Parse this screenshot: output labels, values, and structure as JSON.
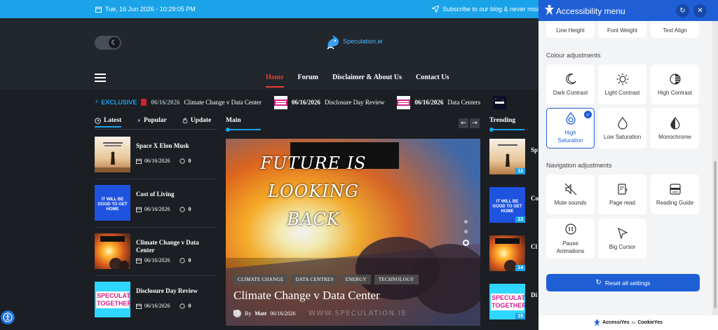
{
  "topbar": {
    "date": "Tue, 16 Jun 2026 - 10:29:05 PM",
    "subscribe": "Subscribe to our blog & never miss ou"
  },
  "header": {
    "logo_text": "Speculation.ie",
    "nav": [
      "Home",
      "Forum",
      "Disclaimer & About Us",
      "Contact Us"
    ]
  },
  "ticker": {
    "label": "EXCLUSIVE",
    "items": [
      {
        "date": "06/16/2026",
        "title": "Climate Change v Data Center"
      },
      {
        "date": "06/16/2026",
        "title": "Disclosure Day Review"
      },
      {
        "date": "06/16/2026",
        "title": "Data Centers"
      }
    ]
  },
  "left_tabs": [
    "Latest",
    "Popular",
    "Update"
  ],
  "posts": [
    {
      "title": "Space X Elon Musk",
      "date": "06/16/2026",
      "comments": "0"
    },
    {
      "title": "Cost of Living",
      "date": "06/16/2026",
      "comments": "0"
    },
    {
      "title": "Climate Change v Data Center",
      "date": "06/16/2026",
      "comments": "0"
    },
    {
      "title": "Disclosure Day Review",
      "date": "06/16/2026",
      "comments": "0"
    }
  ],
  "thumb_text": {
    "cost": "IT WILL BE GOOD TO GET HOME",
    "speculate": "SPECULATE TOGETHER"
  },
  "main": {
    "heading": "Main",
    "hero_text": [
      "FUTURE IS",
      "LOOKING",
      "BACK"
    ],
    "tags": [
      "CLIMATE CHANGE",
      "DATA CENTRES",
      "ENERGY",
      "TECHNOLOGY"
    ],
    "title": "Climate Change v Data Center",
    "author_prefix": "By",
    "author": "Matt",
    "date": "06/16/2026",
    "watermark": "WWW.SPECULATION.IE"
  },
  "trending": {
    "heading": "Trending",
    "items": [
      {
        "num": "12",
        "title": "Sp"
      },
      {
        "num": "13",
        "title": "Co"
      },
      {
        "num": "14",
        "title": "Cl"
      },
      {
        "num": "15",
        "title": "Di"
      }
    ]
  },
  "panel": {
    "title": "Accessibility menu",
    "top_row": [
      "Line Height",
      "Font Weight",
      "Text Align"
    ],
    "colour_label": "Colour adjustments",
    "colour": [
      "Dark Contrast",
      "Light Contrast",
      "High Contrast",
      "High Saturation",
      "Low Saturation",
      "Monochrome"
    ],
    "nav_label": "Navigation adjustments",
    "navigation": [
      "Mute sounds",
      "Page read",
      "Reading Guide",
      "Pause Animations",
      "Big Cursor"
    ],
    "reset": "Reset all settings",
    "footer_brand": "AccessiYes",
    "footer_by": "by",
    "footer_company": "CookieYes"
  },
  "colors": {
    "accent": "#1aa3e9",
    "panel_blue": "#1f5fd6",
    "nav_active": "#e63d2f"
  }
}
